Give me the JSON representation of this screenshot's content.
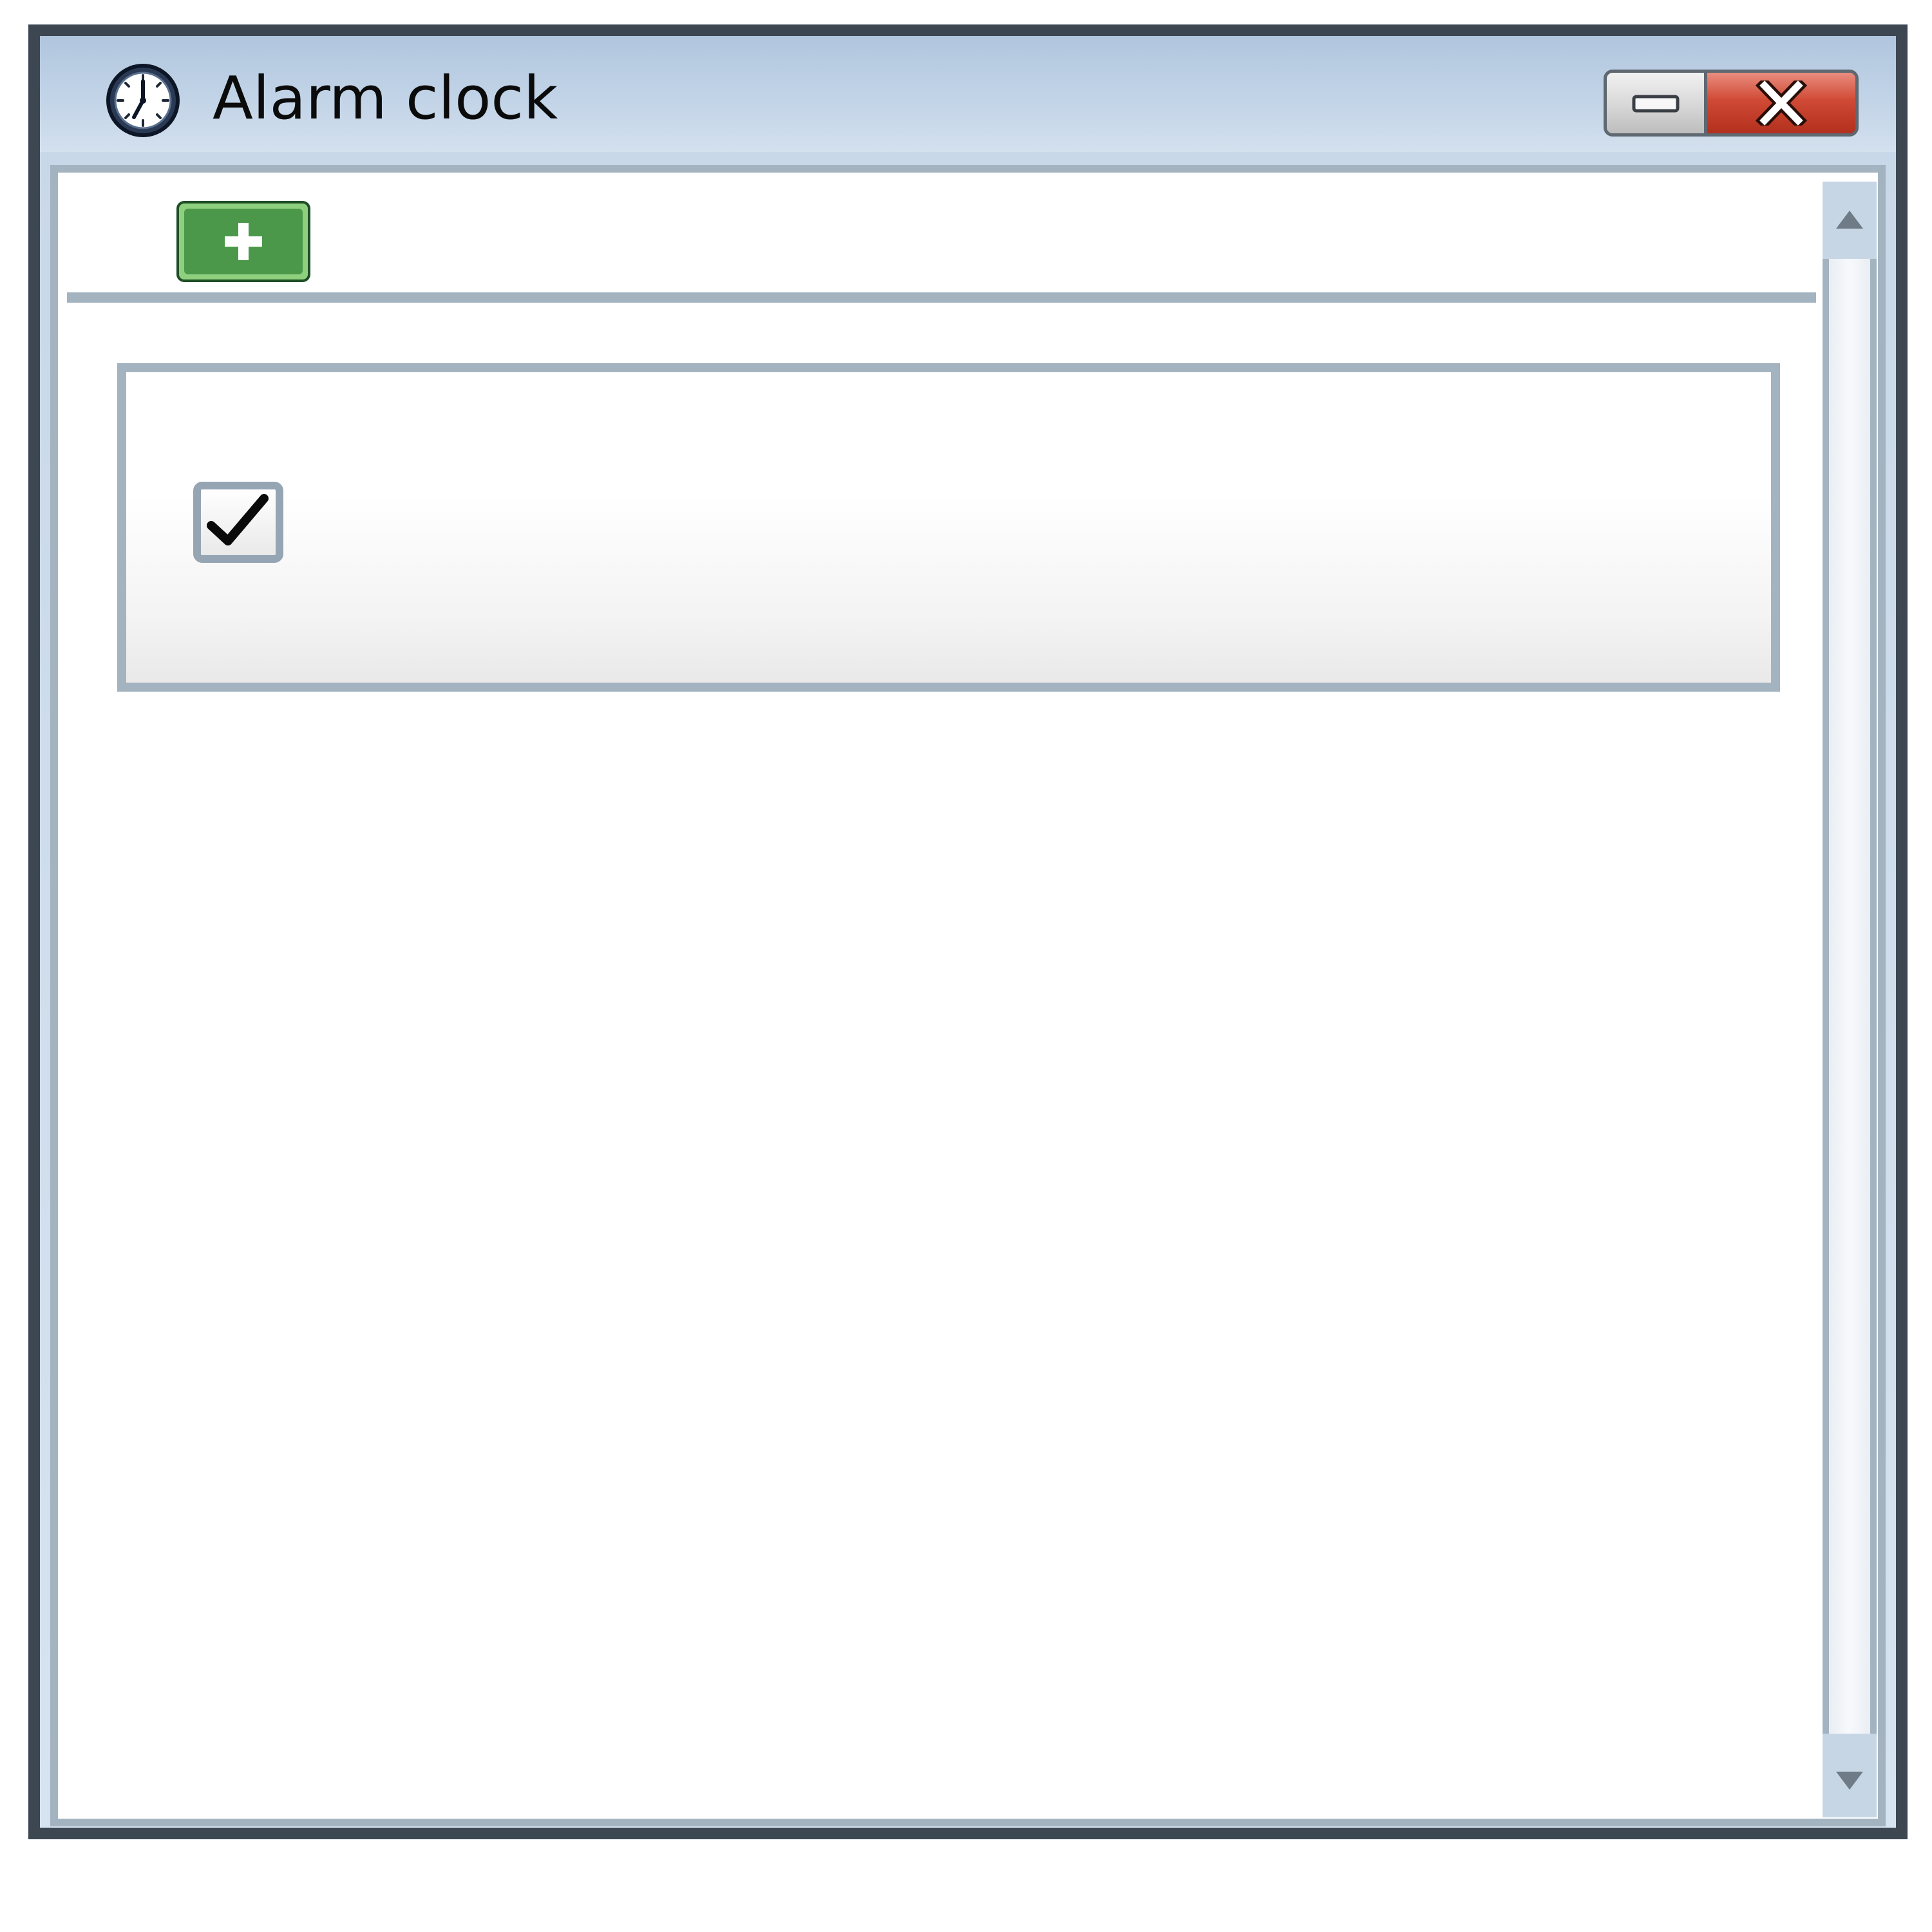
{
  "window": {
    "title": "Alarm clock",
    "app_icon": "alarm-clock-icon",
    "controls": {
      "minimize_icon": "minimize-icon",
      "close_icon": "close-icon"
    }
  },
  "toolbar": {
    "add_icon": "plus-icon"
  },
  "alarms": [
    {
      "enabled": true,
      "checkbox_icon": "checkmark-icon"
    }
  ],
  "scrollbar": {
    "up_icon": "arrow-up-icon",
    "down_icon": "arrow-down-icon"
  },
  "colors": {
    "frame": "#3d4752",
    "border": "#a4b3c0",
    "titlebar": "#c4d5e8",
    "add_button": "#4b984a",
    "close_button": "#d04a35"
  }
}
